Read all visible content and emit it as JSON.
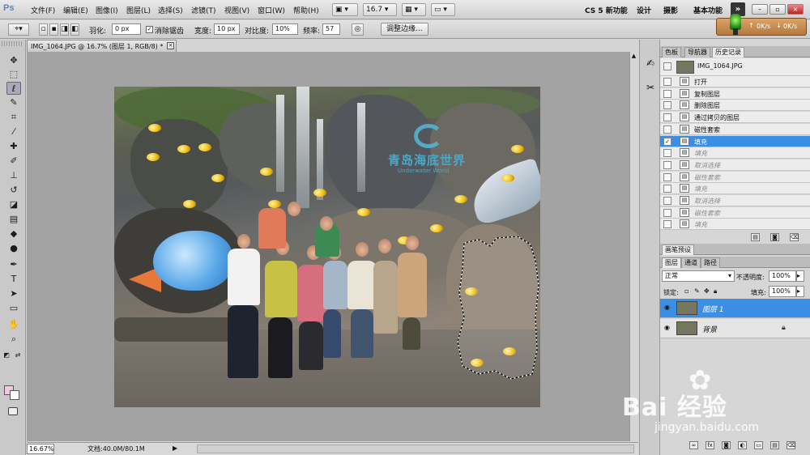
{
  "app": {
    "logo": "Ps",
    "menus": [
      "文件(F)",
      "编辑(E)",
      "图像(I)",
      "图层(L)",
      "选择(S)",
      "滤镜(T)",
      "视图(V)",
      "窗口(W)",
      "帮助(H)"
    ],
    "zoom_dropdown": "16.7",
    "workspaces": [
      "CS 5 新功能",
      "设计",
      "摄影",
      "基本功能"
    ],
    "window_buttons": [
      "–",
      "▫",
      "×"
    ]
  },
  "net": {
    "up": "0K/s",
    "down": "0K/s"
  },
  "options": {
    "feather_label": "羽化:",
    "feather_value": "0 px",
    "antialias_label": "消除锯齿",
    "width_label": "宽度:",
    "width_value": "10 px",
    "contrast_label": "对比度:",
    "contrast_value": "10%",
    "frequency_label": "频率:",
    "frequency_value": "57",
    "refine_edge": "调整边缘..."
  },
  "document": {
    "tab_title": "IMG_1064.JPG @ 16.7% (图层 1, RGB/8) *",
    "close": "×",
    "zoom": "16.67%",
    "doc_size": "文档:40.0M/80.1M"
  },
  "photo_logo": {
    "title": "青岛海底世界",
    "subtitle": "Underwater World"
  },
  "history_panel": {
    "tabs": [
      "色板",
      "导航器",
      "历史记录"
    ],
    "snapshot": "IMG_1064.JPG",
    "items": [
      {
        "label": "打开",
        "state": "normal"
      },
      {
        "label": "复制图层",
        "state": "normal"
      },
      {
        "label": "删除图层",
        "state": "normal"
      },
      {
        "label": "通过拷贝的图层",
        "state": "normal"
      },
      {
        "label": "磁性套索",
        "state": "normal"
      },
      {
        "label": "填充",
        "state": "selected"
      },
      {
        "label": "填充",
        "state": "dim"
      },
      {
        "label": "取消选择",
        "state": "dim"
      },
      {
        "label": "磁性套索",
        "state": "dim"
      },
      {
        "label": "填充",
        "state": "dim"
      },
      {
        "label": "取消选择",
        "state": "dim"
      },
      {
        "label": "磁性套索",
        "state": "dim"
      },
      {
        "label": "填充",
        "state": "dim"
      }
    ]
  },
  "brush_panel": {
    "tab": "画笔预设"
  },
  "layers_panel": {
    "tabs": [
      "图层",
      "通道",
      "路径"
    ],
    "blend_mode": "正常",
    "opacity_label": "不透明度:",
    "opacity_value": "100%",
    "lock_label": "锁定:",
    "fill_label": "填充:",
    "fill_value": "100%",
    "layers": [
      {
        "name": "图层 1",
        "selected": true
      },
      {
        "name": "背景",
        "selected": false
      }
    ]
  },
  "watermark": {
    "brand": "Bai 经验",
    "url": "jingyan.baidu.com"
  }
}
